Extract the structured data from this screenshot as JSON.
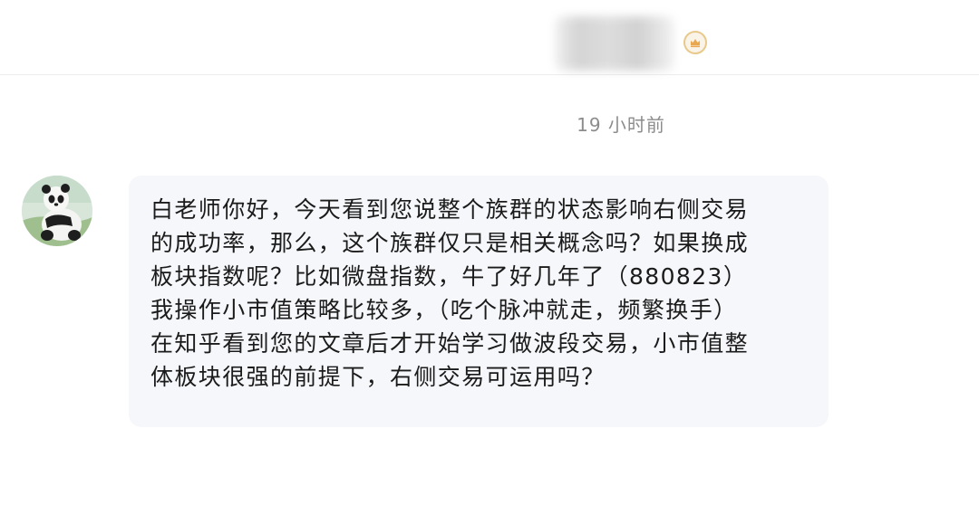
{
  "header": {
    "contact_name_blurred": true,
    "badge_icon": "crown-badge-icon"
  },
  "conversation": {
    "timestamp": "19 小时前",
    "message": {
      "sender_avatar": "panda-avatar",
      "lines": [
        "白老师你好，今天看到您说整个族群的状态影响右侧交易",
        "的成功率，那么，这个族群仅只是相关概念吗？如果换成",
        "板块指数呢？比如微盘指数，牛了好几年了（880823）",
        "我操作小市值策略比较多，（吃个脉冲就走，频繁换手）",
        "在知乎看到您的文章后才开始学习做波段交易，小市值整",
        "体板块很强的前提下，右侧交易可运用吗？"
      ]
    }
  },
  "colors": {
    "bubble_bg": "#f6f7fa",
    "text": "#1b1b1b",
    "timestamp": "#8c8c8c",
    "badge": "#e9a84f"
  }
}
